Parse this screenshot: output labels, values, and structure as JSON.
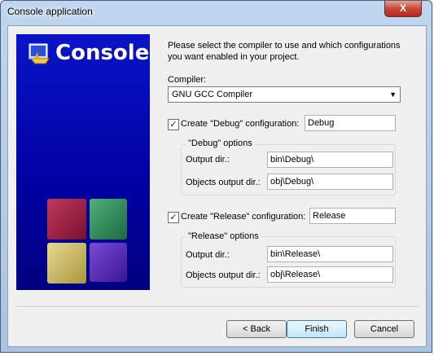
{
  "window": {
    "title": "Console application",
    "close_label": "X"
  },
  "banner": {
    "title": "Console"
  },
  "intro_text": "Please select the compiler to use and which configurations you want enabled in your project.",
  "compiler": {
    "label": "Compiler:",
    "selected": "GNU GCC Compiler"
  },
  "debug": {
    "checkbox_label": "Create \"Debug\" configuration:",
    "checked": true,
    "name": "Debug",
    "group_title": "\"Debug\" options",
    "output_dir_label": "Output dir.:",
    "output_dir": "bin\\Debug\\",
    "obj_dir_label": "Objects output dir.:",
    "obj_dir": "obj\\Debug\\"
  },
  "release": {
    "checkbox_label": "Create \"Release\" configuration:",
    "checked": true,
    "name": "Release",
    "group_title": "\"Release\" options",
    "output_dir_label": "Output dir.:",
    "output_dir": "bin\\Release\\",
    "obj_dir_label": "Objects output dir.:",
    "obj_dir": "obj\\Release\\"
  },
  "buttons": {
    "back": "< Back",
    "finish": "Finish",
    "cancel": "Cancel"
  },
  "icons": {
    "checkbox_mark": "✓",
    "dropdown": "▼"
  }
}
